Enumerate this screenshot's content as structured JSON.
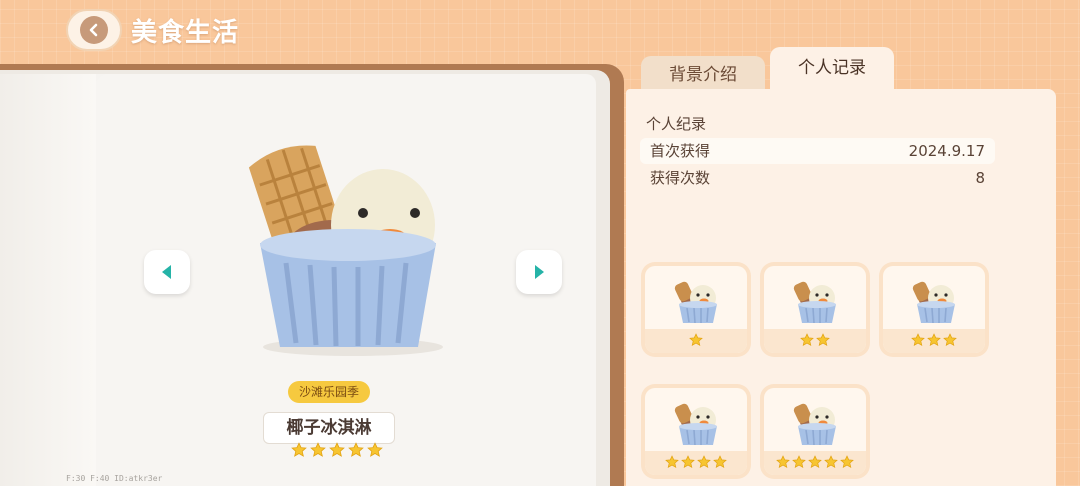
{
  "header": {
    "title": "美食生活"
  },
  "food": {
    "season_tag": "沙滩乐园季",
    "name": "椰子冰淇淋",
    "stars": 5
  },
  "debug": "F:30  F:40  ID:atkr3er",
  "tabs": [
    {
      "label": "背景介绍",
      "active": false
    },
    {
      "label": "个人记录",
      "active": true
    }
  ],
  "record": {
    "title": "个人纪录",
    "rows": [
      {
        "label": "首次获得",
        "value": "2024.9.17"
      },
      {
        "label": "获得次数",
        "value": "8"
      }
    ]
  },
  "variants": [
    {
      "stars": 1
    },
    {
      "stars": 2
    },
    {
      "stars": 3
    },
    {
      "stars": 4
    },
    {
      "stars": 5
    }
  ],
  "colors": {
    "background": "#f9c79b",
    "star": "#f7c531",
    "accent_teal": "#25b3a7",
    "tag": "#f6c93f"
  }
}
